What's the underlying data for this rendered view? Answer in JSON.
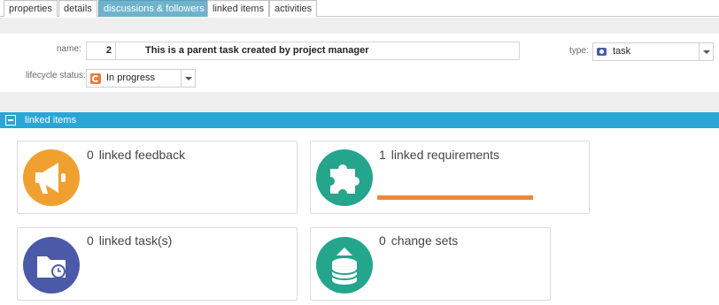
{
  "tabs": [
    {
      "label": "properties",
      "active": false
    },
    {
      "label": "details",
      "active": false
    },
    {
      "label": "discussions & followers",
      "active": true
    },
    {
      "label": "linked items",
      "active": false
    },
    {
      "label": "activities",
      "active": false
    }
  ],
  "form": {
    "name_label": "name:",
    "name_number": "2",
    "name_value": "This is a parent task created by project manager",
    "type_label": "type:",
    "type_value": "task",
    "lifecycle_label": "lifecycle status:",
    "lifecycle_value": "In progress"
  },
  "section": {
    "title": "linked items"
  },
  "cards": [
    {
      "count": "0",
      "label": "linked feedback",
      "icon": "megaphone-icon",
      "color": "#f0a030"
    },
    {
      "count": "1",
      "label": "linked requirements",
      "icon": "puzzle-icon",
      "color": "#24a58c",
      "bar_progress": 0.47
    },
    {
      "count": "0",
      "label": "linked task(s)",
      "icon": "folder-clock-icon",
      "color": "#4a5aa8"
    },
    {
      "count": "0",
      "label": "change sets",
      "icon": "database-upload-icon",
      "color": "#24a58c"
    }
  ],
  "colors": {
    "accent": "#2aa6d6",
    "active_tab": "#6fb2cc",
    "progress_bar": "#ec8a3c",
    "status_icon": "#f07a3c",
    "type_icon": "#4a5aa8"
  }
}
